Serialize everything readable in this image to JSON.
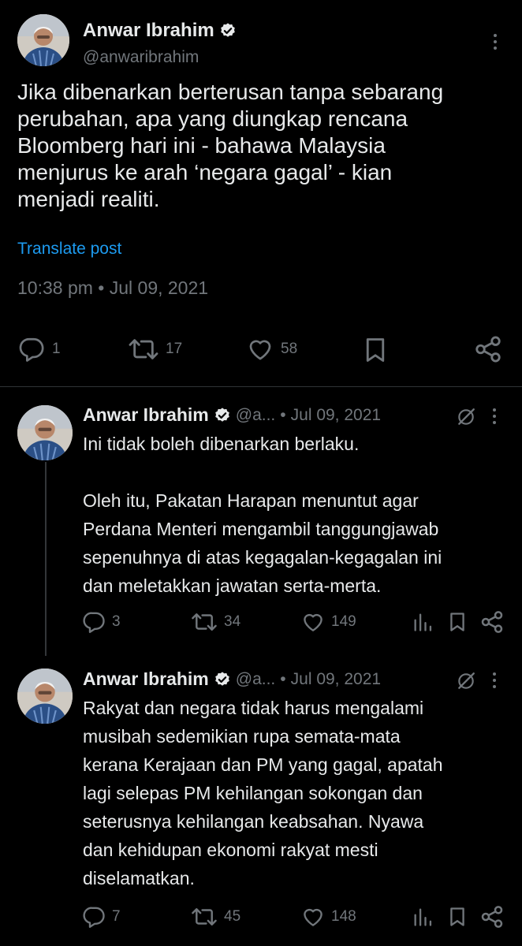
{
  "main": {
    "author_name": "Anwar Ibrahim",
    "handle": "@anwaribrahim",
    "text": "Jika dibenarkan berterusan tanpa sebarang\nperubahan, apa yang diungkap rencana\nBloomberg hari ini - bahawa Malaysia\nmenjurus ke arah ‘negara gagal’ - kian\nmenjadi realiti.",
    "translate_label": "Translate post",
    "timestamp": "10:38 pm • Jul 09, 2021",
    "replies": "1",
    "reposts": "17",
    "likes": "58"
  },
  "replies": [
    {
      "author_name": "Anwar Ibrahim",
      "handle": "@a...",
      "date": "Jul 09, 2021",
      "text": "Ini tidak boleh dibenarkan berlaku.\n\nOleh itu, Pakatan Harapan menuntut agar\nPerdana Menteri mengambil tanggungjawab\nsepenuhnya di atas kegagalan-kegagalan ini\ndan meletakkan jawatan serta-merta.",
      "replies": "3",
      "reposts": "34",
      "likes": "149"
    },
    {
      "author_name": "Anwar Ibrahim",
      "handle": "@a...",
      "date": "Jul 09, 2021",
      "text": "Rakyat dan negara tidak harus mengalami\nmusibah sedemikian rupa semata-mata\nkerana Kerajaan dan PM yang gagal, apatah\nlagi selepas PM kehilangan sokongan dan\nseterusnya kehilangan keabsahan. Nyawa\ndan kehidupan ekonomi rakyat mesti\ndiselamatkan.",
      "replies": "7",
      "reposts": "45",
      "likes": "148"
    }
  ],
  "separator_dot": "•",
  "colors": {
    "background": "#000000",
    "text": "#e7e9ea",
    "muted": "#71767b",
    "link": "#1d9bf0",
    "verified": "#e7e9ea"
  },
  "icons": {
    "verified": "verified-badge-icon",
    "more": "more-dots-icon",
    "reply": "reply-bubble-icon",
    "repost": "repost-icon",
    "like": "heart-icon",
    "bookmark": "bookmark-icon",
    "share": "share-icon",
    "views": "views-bars-icon",
    "grok": "grok-icon"
  }
}
